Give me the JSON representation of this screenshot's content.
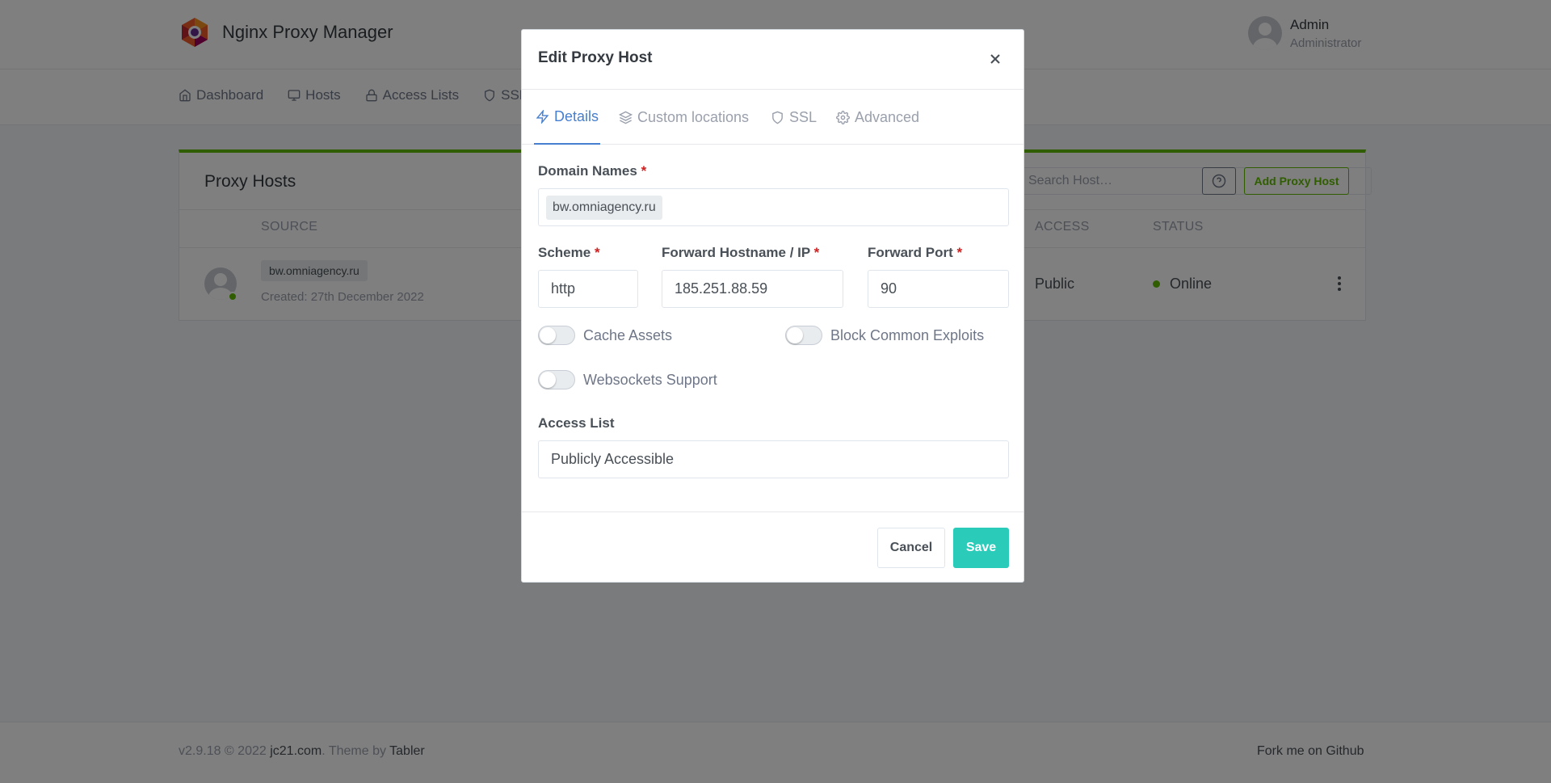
{
  "app": {
    "name": "Nginx Proxy Manager",
    "user_name": "Admin",
    "user_role": "Administrator"
  },
  "nav": {
    "items": [
      {
        "label": "Dashboard",
        "icon": "home-icon"
      },
      {
        "label": "Hosts",
        "icon": "monitor-icon"
      },
      {
        "label": "Access Lists",
        "icon": "lock-icon"
      },
      {
        "label": "SSL",
        "icon": "shield-icon"
      }
    ]
  },
  "card": {
    "title": "Proxy Hosts",
    "search_placeholder": "Search Host…",
    "add_button": "Add Proxy Host",
    "columns": [
      "SOURCE",
      "ACCESS",
      "STATUS"
    ],
    "rows": [
      {
        "domain": "bw.omniagency.ru",
        "created": "Created: 27th December 2022",
        "access": "Public",
        "status": "Online"
      }
    ]
  },
  "modal": {
    "title": "Edit Proxy Host",
    "tabs": [
      {
        "label": "Details",
        "icon": "zap-icon",
        "active": true
      },
      {
        "label": "Custom locations",
        "icon": "layers-icon",
        "active": false
      },
      {
        "label": "SSL",
        "icon": "shield-icon",
        "active": false
      },
      {
        "label": "Advanced",
        "icon": "settings-icon",
        "active": false
      }
    ],
    "domain_names_label": "Domain Names",
    "domain_names": [
      "bw.omniagency.ru"
    ],
    "scheme_label": "Scheme",
    "scheme_value": "http",
    "forward_host_label": "Forward Hostname / IP",
    "forward_host_value": "185.251.88.59",
    "forward_port_label": "Forward Port",
    "forward_port_value": "90",
    "required_mark": "*",
    "toggles": {
      "cache_assets": {
        "label": "Cache Assets",
        "on": false
      },
      "block_exploits": {
        "label": "Block Common Exploits",
        "on": false
      },
      "websockets": {
        "label": "Websockets Support",
        "on": false
      }
    },
    "access_list_label": "Access List",
    "access_list_value": "Publicly Accessible",
    "cancel_label": "Cancel",
    "save_label": "Save"
  },
  "footer": {
    "version": "v2.9.18 © 2022",
    "author": "jc21.com",
    "theme_by": ". Theme by",
    "theme": "Tabler",
    "fork": "Fork me on Github"
  },
  "colors": {
    "primary": "#467fcf",
    "success": "#5eba00",
    "teal": "#2bcbba",
    "danger": "#cd201f"
  }
}
